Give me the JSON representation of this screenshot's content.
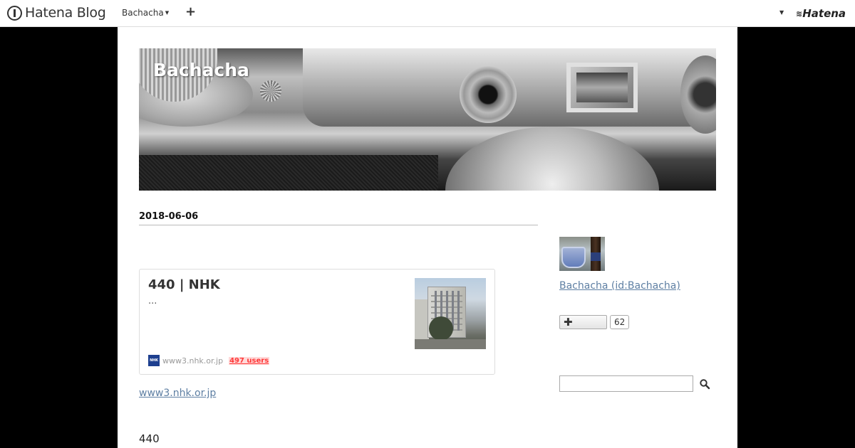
{
  "topbar": {
    "logo_text": "Hatena Blog",
    "blog_menu": "Bachacha",
    "add_button": "+",
    "hatena_logo": "Hatena"
  },
  "blog": {
    "title": "Bachacha"
  },
  "entry": {
    "date": "2018-06-06",
    "card": {
      "title": "440  | NHK",
      "description": "...",
      "favicon_text": "NHK",
      "domain": "www3.nhk.or.jp",
      "users": "497 users"
    },
    "source_link": "www3.nhk.or.jp",
    "body_text": "440"
  },
  "sidebar": {
    "profile_name": "Bachacha (id:Bachacha)",
    "follow_count": "62",
    "search_placeholder": ""
  },
  "colors": {
    "link": "#5e7fa3",
    "users_badge": "#ff3a3a",
    "background": "#000000"
  }
}
